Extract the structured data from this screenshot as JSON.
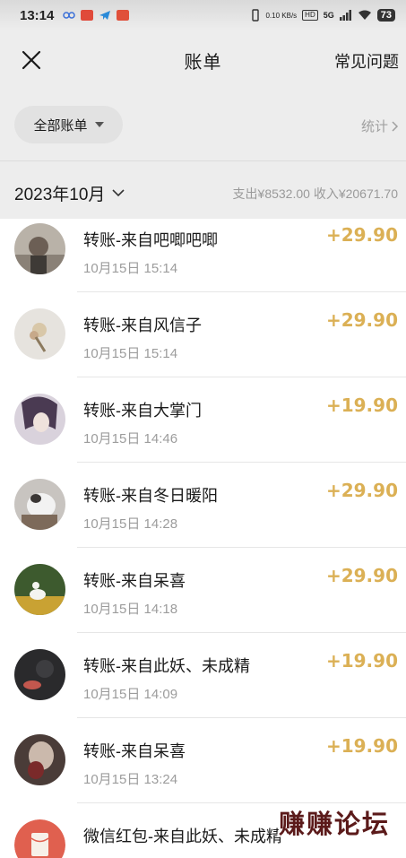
{
  "status_bar": {
    "time": "13:14",
    "speed": "0.10 KB/s",
    "hd": "HD",
    "network": "5G",
    "battery": "73"
  },
  "nav": {
    "title": "账单",
    "faq_label": "常见问题"
  },
  "filter": {
    "label": "全部账单",
    "stats_label": "统计"
  },
  "month": {
    "label": "2023年10月",
    "summary": "支出¥8532.00 收入¥20671.70"
  },
  "transactions": [
    {
      "title": "转账-来自吧唧吧唧",
      "time": "10月15日 15:14",
      "amount": "+29.90"
    },
    {
      "title": "转账-来自风信子",
      "time": "10月15日 15:14",
      "amount": "+29.90"
    },
    {
      "title": "转账-来自大掌门",
      "time": "10月15日 14:46",
      "amount": "+19.90"
    },
    {
      "title": "转账-来自冬日暖阳",
      "time": "10月15日 14:28",
      "amount": "+29.90"
    },
    {
      "title": "转账-来自呆喜",
      "time": "10月15日 14:18",
      "amount": "+29.90"
    },
    {
      "title": "转账-来自此妖、未成精",
      "time": "10月15日 14:09",
      "amount": "+19.90"
    },
    {
      "title": "转账-来自呆喜",
      "time": "10月15日 13:24",
      "amount": "+19.90"
    },
    {
      "title": "微信红包-来自此妖、未成精",
      "time": "",
      "amount": ""
    }
  ],
  "watermark": "赚赚论坛",
  "colors": {
    "amount": "#dbb055",
    "header_bg": "#ededed",
    "red_packet": "#e0604f"
  }
}
